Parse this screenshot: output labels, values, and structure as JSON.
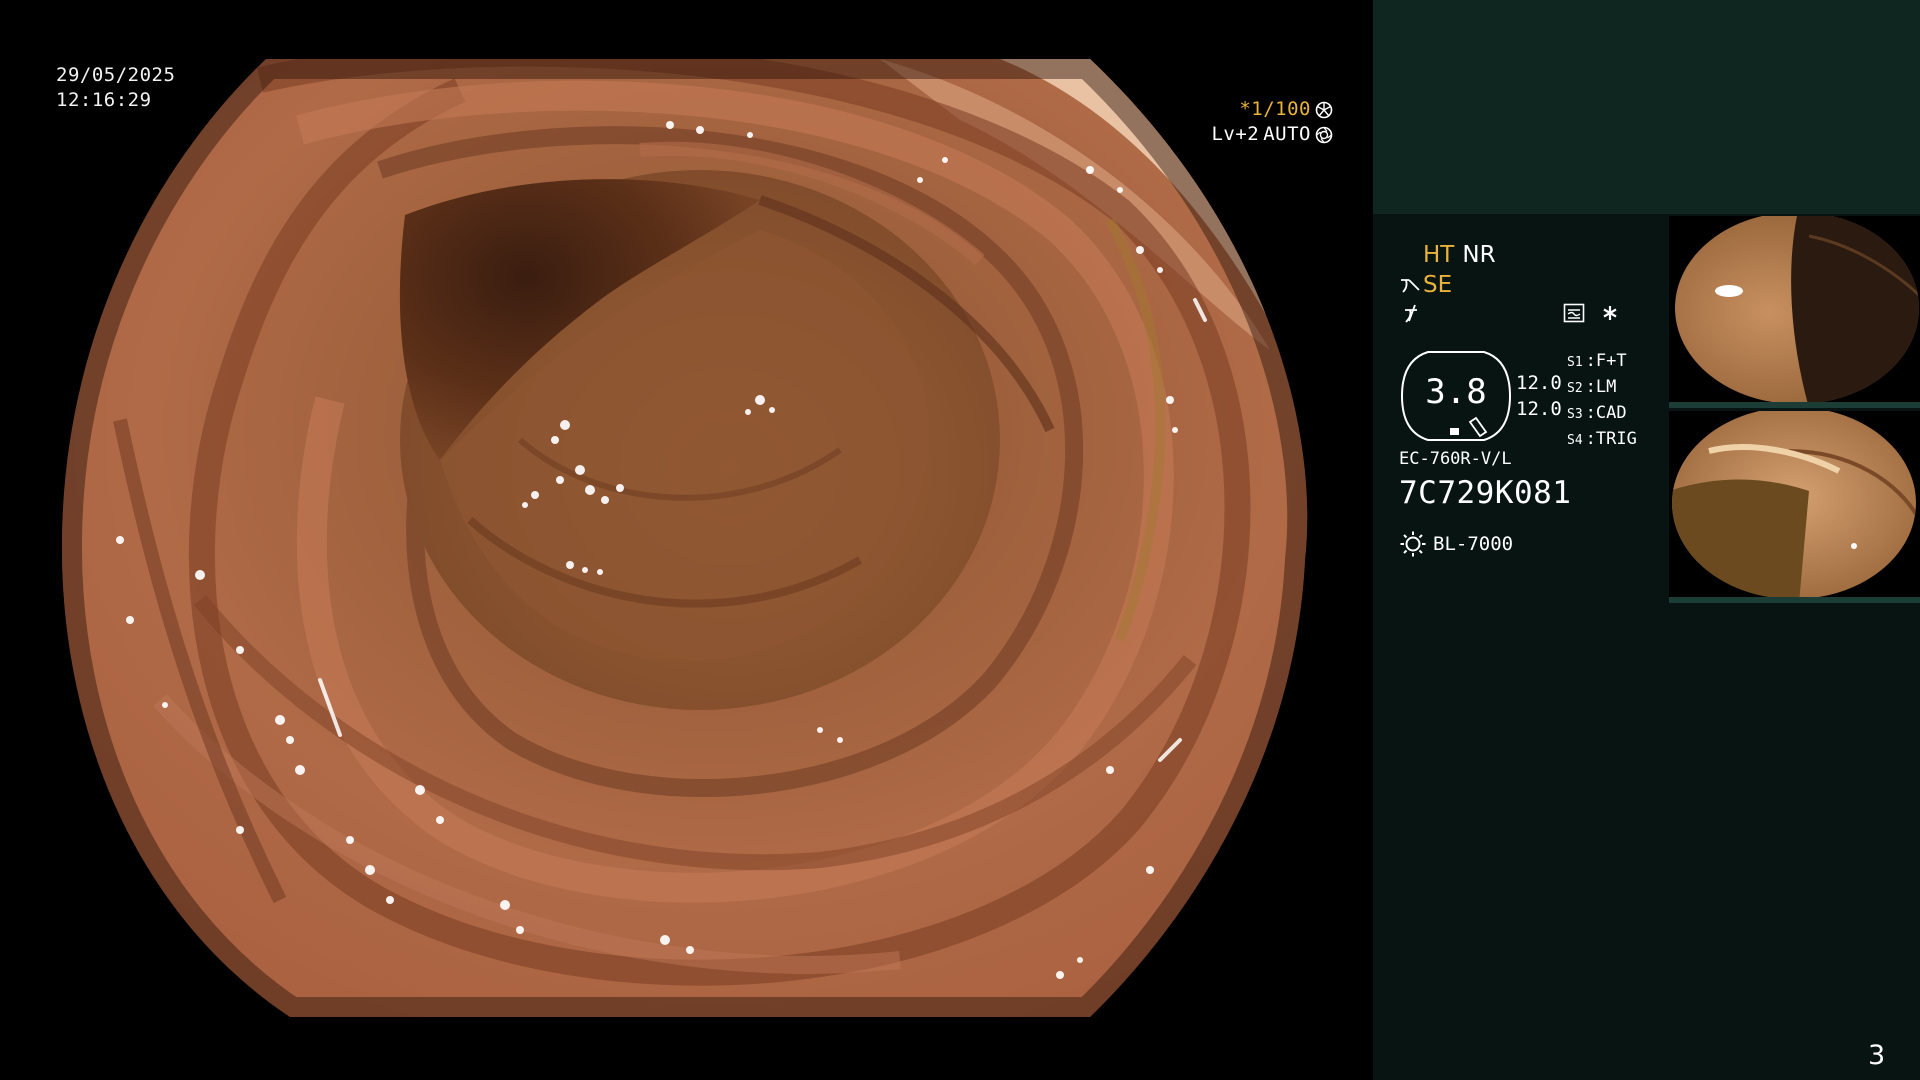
{
  "osd": {
    "date": "29/05/2025",
    "time": "12:16:29",
    "shutter": "*1/100",
    "level": "Lv+2",
    "iris": "AUTO"
  },
  "panel": {
    "mode_ht": "HT",
    "mode_nr": "NR",
    "mode_se": "SE",
    "zoom": "3.8",
    "value_top": "12.0",
    "value_bottom": "12.0",
    "switches": [
      {
        "key": "S1",
        "value": "F+T"
      },
      {
        "key": "S2",
        "value": "LM"
      },
      {
        "key": "S3",
        "value": "CAD"
      },
      {
        "key": "S4",
        "value": "TRIG"
      }
    ],
    "scope_model": "EC-760R-V/L",
    "serial": "7C729K081",
    "light_source": "BL-7000",
    "page_number": "3"
  },
  "colors": {
    "panel_bg": "#071412",
    "panel_top": "#0f2520",
    "accent_yellow": "#e9b23a",
    "mucosa": "#b46a45"
  },
  "icons": [
    "shutter-icon",
    "iris-icon",
    "structure-enhance-icon",
    "color-mode-icon",
    "freeze-icon",
    "asterisk-icon",
    "light-source-icon"
  ]
}
